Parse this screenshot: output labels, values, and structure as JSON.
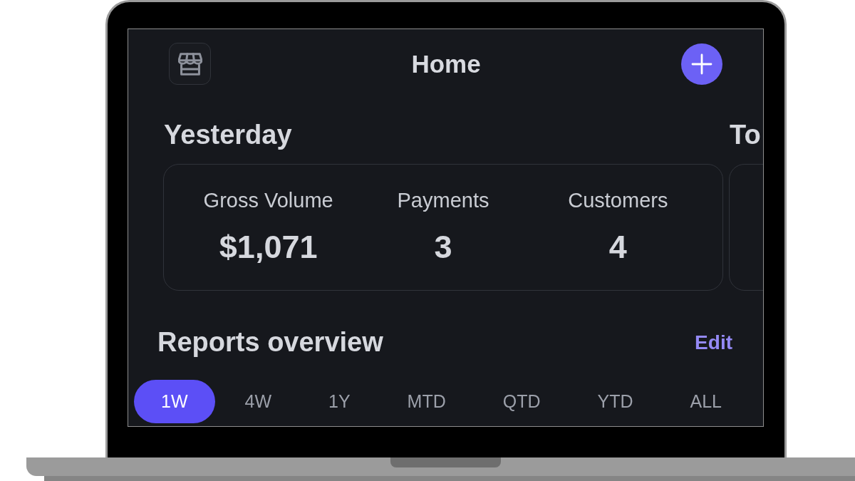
{
  "header": {
    "title": "Home"
  },
  "summaries": [
    {
      "title": "Yesterday",
      "metrics": [
        {
          "label": "Gross Volume",
          "value": "$1,071"
        },
        {
          "label": "Payments",
          "value": "3"
        },
        {
          "label": "Customers",
          "value": "4"
        }
      ]
    },
    {
      "title": "To"
    }
  ],
  "reports": {
    "title": "Reports overview",
    "action": "Edit",
    "periods": [
      {
        "label": "1W",
        "selected": true
      },
      {
        "label": "4W",
        "selected": false
      },
      {
        "label": "1Y",
        "selected": false
      },
      {
        "label": "MTD",
        "selected": false
      },
      {
        "label": "QTD",
        "selected": false
      },
      {
        "label": "YTD",
        "selected": false
      },
      {
        "label": "ALL",
        "selected": false
      }
    ]
  }
}
